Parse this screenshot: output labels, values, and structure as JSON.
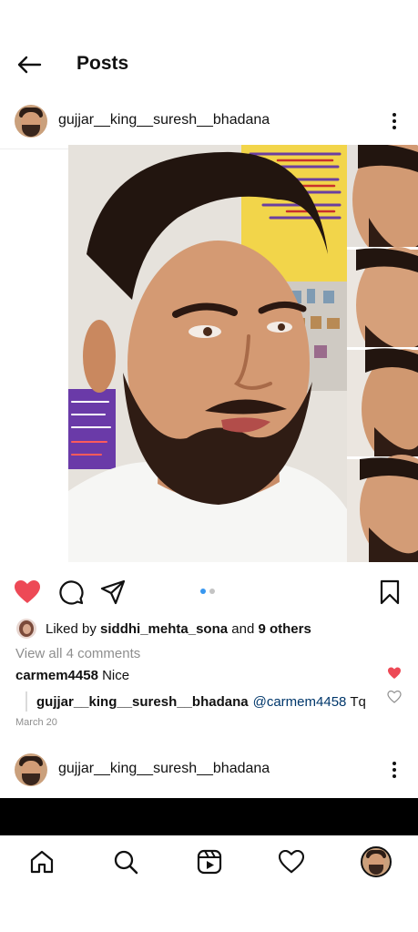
{
  "header": {
    "title": "Posts",
    "back_icon": "arrow-left-icon"
  },
  "post": {
    "username": "gujjar__king__suresh__bhadana",
    "image_description_icon": "photo",
    "carousel": {
      "count": 2,
      "active_index": 0
    },
    "liked": true,
    "likes": {
      "prefix": "Liked by",
      "user": "siddhi_mehta_sona",
      "connector": "and",
      "others": "9 others"
    },
    "view_comments": "View all 4 comments",
    "comment": {
      "user": "carmem4458",
      "text": "Nice",
      "liked": true
    },
    "reply": {
      "user": "gujjar__king__suresh__bhadana",
      "mention": "@carmem4458",
      "text": "Tq",
      "liked": false
    },
    "date": "March 20"
  },
  "next_post": {
    "username": "gujjar__king__suresh__bhadana"
  },
  "colors": {
    "like_red": "#ed4956",
    "carousel_active": "#3897f0",
    "mention": "#00376b",
    "muted": "#8e8e8e"
  },
  "tabs": [
    "home-icon",
    "search-icon",
    "reels-icon",
    "activity-heart-icon",
    "profile-avatar"
  ]
}
